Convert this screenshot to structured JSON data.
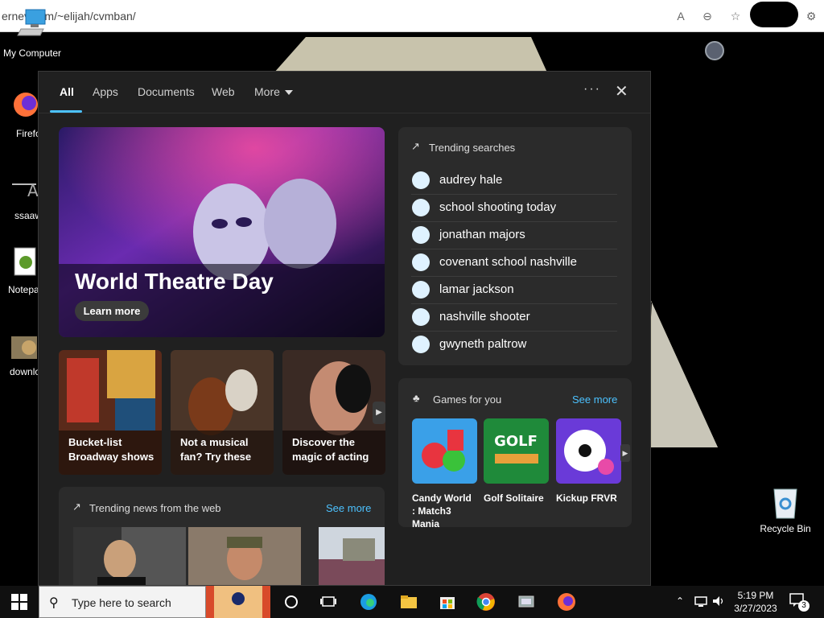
{
  "browser": {
    "url": "ernev...om/~elijah/cvmban/"
  },
  "desktop": {
    "icons": [
      {
        "label": "My Computer"
      },
      {
        "label": "Firefo"
      },
      {
        "label": "ssaaw"
      },
      {
        "label": "Notepa"
      },
      {
        "label": "downlo"
      },
      {
        "label": "Recycle Bin"
      }
    ]
  },
  "search_panel": {
    "tabs": [
      "All",
      "Apps",
      "Documents",
      "Web",
      "More"
    ],
    "active_tab": "All",
    "hero": {
      "title": "World Theatre Day",
      "button": "Learn more"
    },
    "cards": [
      {
        "caption": "Bucket-list Broadway shows"
      },
      {
        "caption": "Not a musical fan? Try these"
      },
      {
        "caption": "Discover the magic of acting"
      }
    ],
    "trending_news": {
      "header": "Trending news from the web",
      "see_more": "See more"
    },
    "trending_searches": {
      "header": "Trending searches",
      "items": [
        "audrey hale",
        "school shooting today",
        "jonathan majors",
        "covenant school nashville",
        "lamar jackson",
        "nashville shooter",
        "gwyneth paltrow"
      ]
    },
    "games": {
      "header": "Games for you",
      "see_more": "See more",
      "items": [
        {
          "name": "Candy World : Match3 Mania"
        },
        {
          "name": "Golf Solitaire"
        },
        {
          "name": "Kickup FRVR"
        }
      ]
    }
  },
  "taskbar": {
    "search_placeholder": "Type here to search",
    "time": "5:19 PM",
    "date": "3/27/2023",
    "notification_count": "3"
  }
}
